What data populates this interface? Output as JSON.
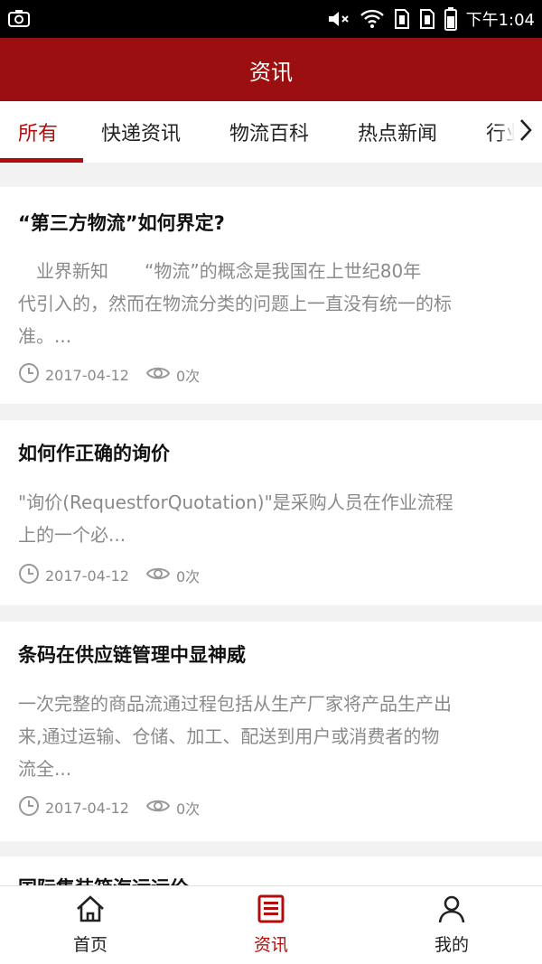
{
  "status_bar": {
    "time": "下午1:04",
    "icons": [
      "screenshot-icon",
      "mute-icon",
      "wifi-icon",
      "sim1-icon",
      "sim2-icon",
      "battery-icon"
    ]
  },
  "header": {
    "title": "资讯"
  },
  "tabs": [
    {
      "label": "所有",
      "active": true
    },
    {
      "label": "快递资讯",
      "active": false
    },
    {
      "label": "物流百科",
      "active": false
    },
    {
      "label": "热点新闻",
      "active": false
    },
    {
      "label": "行业",
      "active": false
    }
  ],
  "articles": [
    {
      "title": "“第三方物流”如何界定?",
      "desc_lines": [
        "　业界新知　　“物流”的概念是我国在上世纪80年",
        "代引入的，然而在物流分类的问题上一直没有统一的标",
        "准。..."
      ],
      "date": "2017-04-12",
      "views": "0次"
    },
    {
      "title": "如何作正确的询价",
      "desc_lines": [
        "\"询价(RequestforQuotation)\"是采购人员在作业流程",
        "上的一个必..."
      ],
      "date": "2017-04-12",
      "views": "0次"
    },
    {
      "title": "条码在供应链管理中显神威",
      "desc_lines": [
        "一次完整的商品流通过程包括从生产厂家将产品生产出",
        "来,通过运输、仓储、加工、配送到用户或消费者的物",
        "流全..."
      ],
      "date": "2017-04-12",
      "views": "0次"
    },
    {
      "title": "国际集装箱海运运价",
      "desc_lines": [],
      "date": "",
      "views": ""
    }
  ],
  "bottom_nav": [
    {
      "label": "首页",
      "icon": "home-icon",
      "active": false
    },
    {
      "label": "资讯",
      "icon": "news-icon",
      "active": true
    },
    {
      "label": "我的",
      "icon": "user-icon",
      "active": false
    }
  ],
  "colors": {
    "brand": "#9b0f10",
    "accent": "#b20d0d",
    "muted": "#8a8a8a"
  }
}
